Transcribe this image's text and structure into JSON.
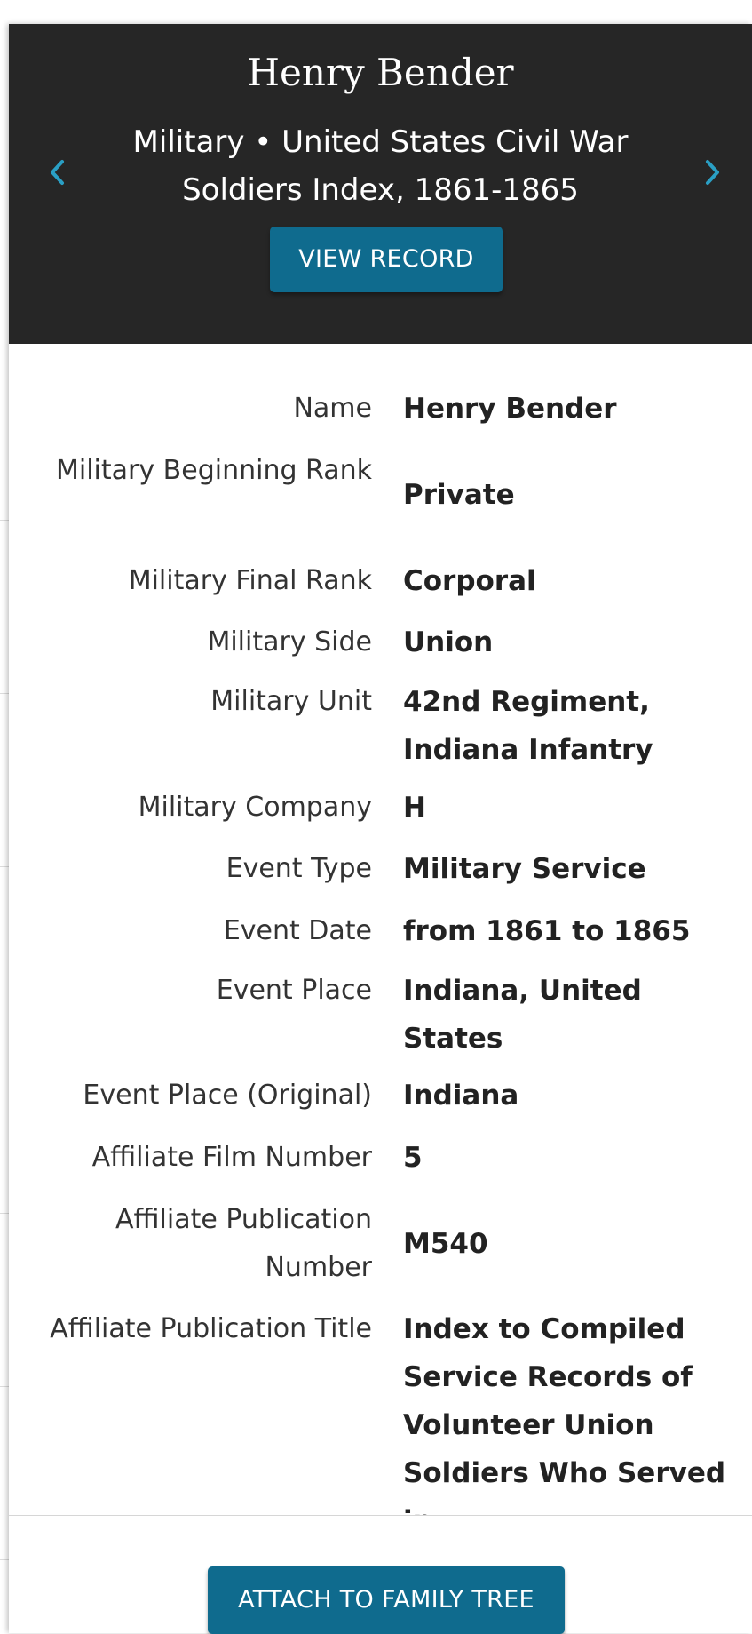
{
  "header": {
    "title": "Henry Bender",
    "subtitle": "Military • United States Civil War Soldiers Index, 1861-1865",
    "view_record_label": "VIEW RECORD"
  },
  "details": {
    "rows": [
      {
        "label": "Name",
        "value": "Henry Bender"
      },
      {
        "label": "Military Beginning Rank",
        "value": "Private"
      },
      {
        "label": "Military Final Rank",
        "value": "Corporal"
      },
      {
        "label": "Military Side",
        "value": "Union"
      },
      {
        "label": "Military Unit",
        "value": "42nd Regiment, Indiana Infantry"
      },
      {
        "label": "Military Company",
        "value": "H"
      },
      {
        "label": "Event Type",
        "value": "Military Service"
      },
      {
        "label": "Event Date",
        "value": "from 1861 to 1865"
      },
      {
        "label": "Event Place",
        "value": "Indiana, United States"
      },
      {
        "label": "Event Place (Original)",
        "value": "Indiana"
      },
      {
        "label": "Affiliate Film Number",
        "value": "5"
      },
      {
        "label": "Affiliate Publication Number",
        "value": "M540"
      },
      {
        "label": "Affiliate Publication Title",
        "value": "Index to Compiled Service Records of Volunteer Union Soldiers Who Served in"
      }
    ]
  },
  "footer": {
    "attach_label": "ATTACH TO FAMILY TREE"
  },
  "icons": {
    "prev": "chevron-left-icon",
    "next": "chevron-right-icon"
  },
  "colors": {
    "header_bg": "#262626",
    "button_bg": "#0f6b8e",
    "arrow": "#2a9fc4"
  }
}
